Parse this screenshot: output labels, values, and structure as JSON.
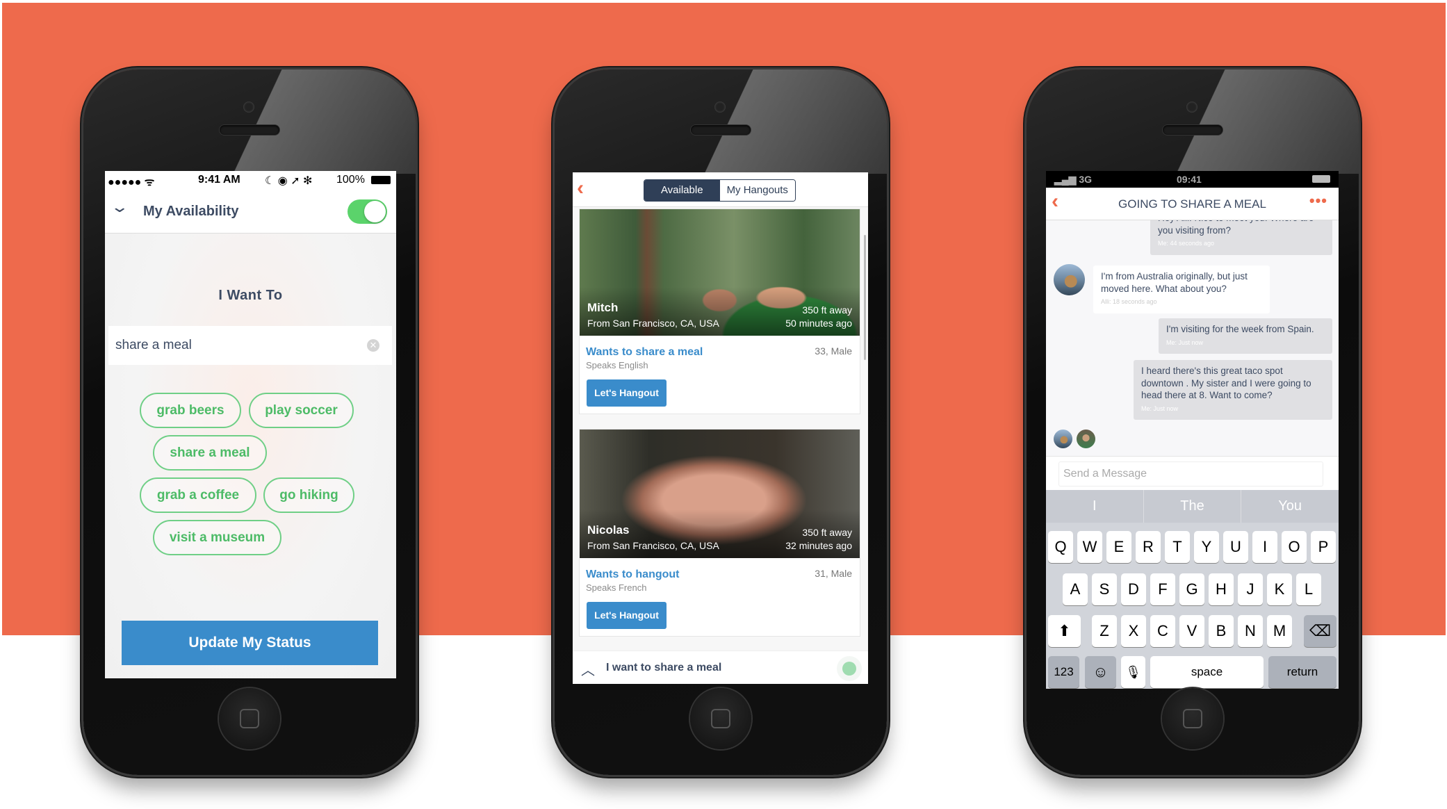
{
  "brand_color": "#ee6a4c",
  "phone1": {
    "status": {
      "signal": "●●●●● ᯤ",
      "time": "9:41 AM",
      "icons": "☾ ◉ ➚ ✻",
      "battery": "100%"
    },
    "header": {
      "icon": "chevron-down-icon",
      "title": "My Availability",
      "toggle_on": true
    },
    "heading": "I Want To",
    "input": {
      "value": "share a meal",
      "clear_icon": "clear-icon"
    },
    "chips": [
      "grab beers",
      "play soccer",
      "share a meal",
      "grab a coffee",
      "go hiking",
      "visit a museum"
    ],
    "button": "Update My Status",
    "accent_green": "#5bd36b",
    "accent_blue": "#3a8ccb"
  },
  "phone2": {
    "tabs": [
      {
        "label": "Available",
        "active": true
      },
      {
        "label": "My Hangouts",
        "active": false
      }
    ],
    "cards": [
      {
        "name": "Mitch",
        "from": "From San Francisco, CA, USA",
        "distance": "350 ft away",
        "time": "50 minutes ago",
        "wants": "Wants to share a meal",
        "speaks": "Speaks English",
        "age": "33, Male",
        "button": "Let's Hangout"
      },
      {
        "name": "Nicolas",
        "from": "From San Francisco, CA, USA",
        "distance": "350 ft away",
        "time": "32 minutes ago",
        "wants": "Wants to hangout",
        "speaks": "Speaks French",
        "age": "31, Male",
        "button": "Let's Hangout"
      }
    ],
    "bottom": "I want to share a meal"
  },
  "phone3": {
    "status": {
      "signal": "▂▄▆ 3G",
      "time": "09:41"
    },
    "title": "GOING TO SHARE A MEAL",
    "messages": [
      {
        "text": "Hey Alli! Nice to meet you. Where are you visiting from?",
        "meta": "Me: 44 seconds ago",
        "mine": true
      },
      {
        "text": "I'm from Australia originally, but just moved here. What about you?",
        "meta": "Alli: 18 seconds ago",
        "mine": false
      },
      {
        "text": "I'm visiting for the week from Spain.",
        "meta": "Me: Just now",
        "mine": true
      },
      {
        "text": "I heard there's this great taco spot downtown . My sister and I were going to head there at 8. Want to come?",
        "meta": "Me: Just now",
        "mine": true
      }
    ],
    "input_placeholder": "Send a Message",
    "suggestions": [
      "I",
      "The",
      "You"
    ],
    "keyboard": {
      "row1": [
        "Q",
        "W",
        "E",
        "R",
        "T",
        "Y",
        "U",
        "I",
        "O",
        "P"
      ],
      "row2": [
        "A",
        "S",
        "D",
        "F",
        "G",
        "H",
        "J",
        "K",
        "L"
      ],
      "row3": [
        "Z",
        "X",
        "C",
        "V",
        "B",
        "N",
        "M"
      ],
      "shift": "⬆",
      "backspace": "⌫",
      "numbers": "123",
      "emoji": "☺",
      "mic": "🎙",
      "space": "space",
      "return": "return"
    }
  }
}
